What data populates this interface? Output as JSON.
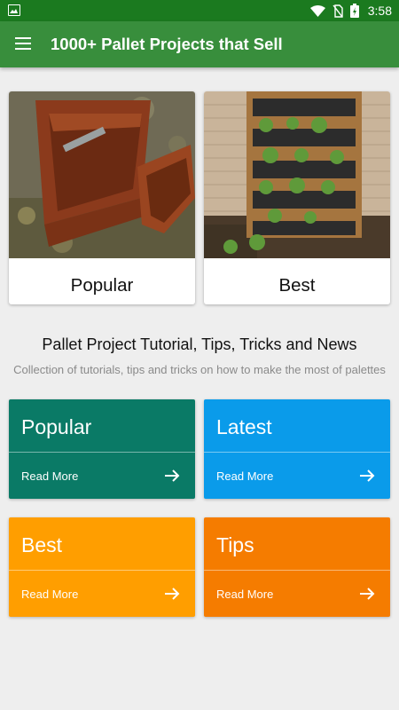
{
  "status_bar": {
    "time": "3:58",
    "icons": [
      "image-notification-icon",
      "wifi-icon",
      "no-sim-icon",
      "battery-charging-icon"
    ]
  },
  "app_bar": {
    "title": "1000+ Pallet Projects that Sell",
    "menu_icon": "hamburger-menu-icon"
  },
  "featured": [
    {
      "label": "Popular",
      "image": "wooden-box-photo"
    },
    {
      "label": "Best",
      "image": "pallet-herb-garden-photo"
    }
  ],
  "section": {
    "heading": "Pallet Project Tutorial, Tips, Tricks and News",
    "subheading": "Collection of tutorials, tips and tricks on how to make the most of palettes"
  },
  "tiles": [
    {
      "title": "Popular",
      "action": "Read More",
      "color": "#0a7a66"
    },
    {
      "title": "Latest",
      "action": "Read More",
      "color": "#0a9bea"
    },
    {
      "title": "Best",
      "action": "Read More",
      "color": "#ff9e00"
    },
    {
      "title": "Tips",
      "action": "Read More",
      "color": "#f57c00"
    }
  ],
  "colors": {
    "status_bar": "#1b7a1f",
    "app_bar": "#388e3c",
    "background": "#eeeeee"
  }
}
